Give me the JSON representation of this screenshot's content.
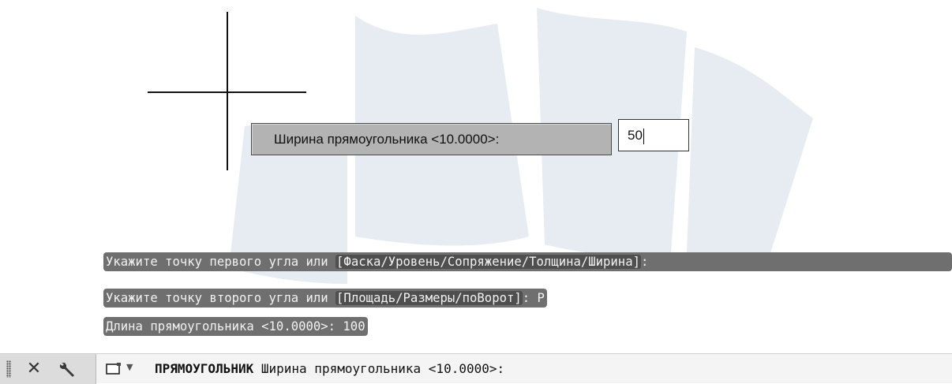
{
  "drawing": {
    "dynamic_prompt": "Ширина прямоугольника <10.0000>:",
    "dynamic_value": "50"
  },
  "history": {
    "line1": {
      "text": "Укажите точку первого угла или ",
      "options": "[Фаска/Уровень/Сопряжение/Толщина/Ширина]",
      "tail": ":"
    },
    "line2": {
      "text": "Укажите точку второго угла или ",
      "options": "[Площадь/Размеры/поВорот]",
      "tail": ": Р"
    },
    "line3": {
      "text": "Длина прямоугольника <10.0000>: 100"
    }
  },
  "command_line": {
    "command_name": "ПРЯМОУГОЛЬНИК",
    "prompt": "Ширина прямоугольника <10.0000>:"
  },
  "icons": {
    "close": "close-icon",
    "customize": "wrench-icon",
    "recent_commands": "rectangle-command-icon"
  },
  "colors": {
    "history_bg": "#6f6f6f",
    "tooltip_bg": "#b3b3b3",
    "watermark": "#e4ebf2"
  }
}
